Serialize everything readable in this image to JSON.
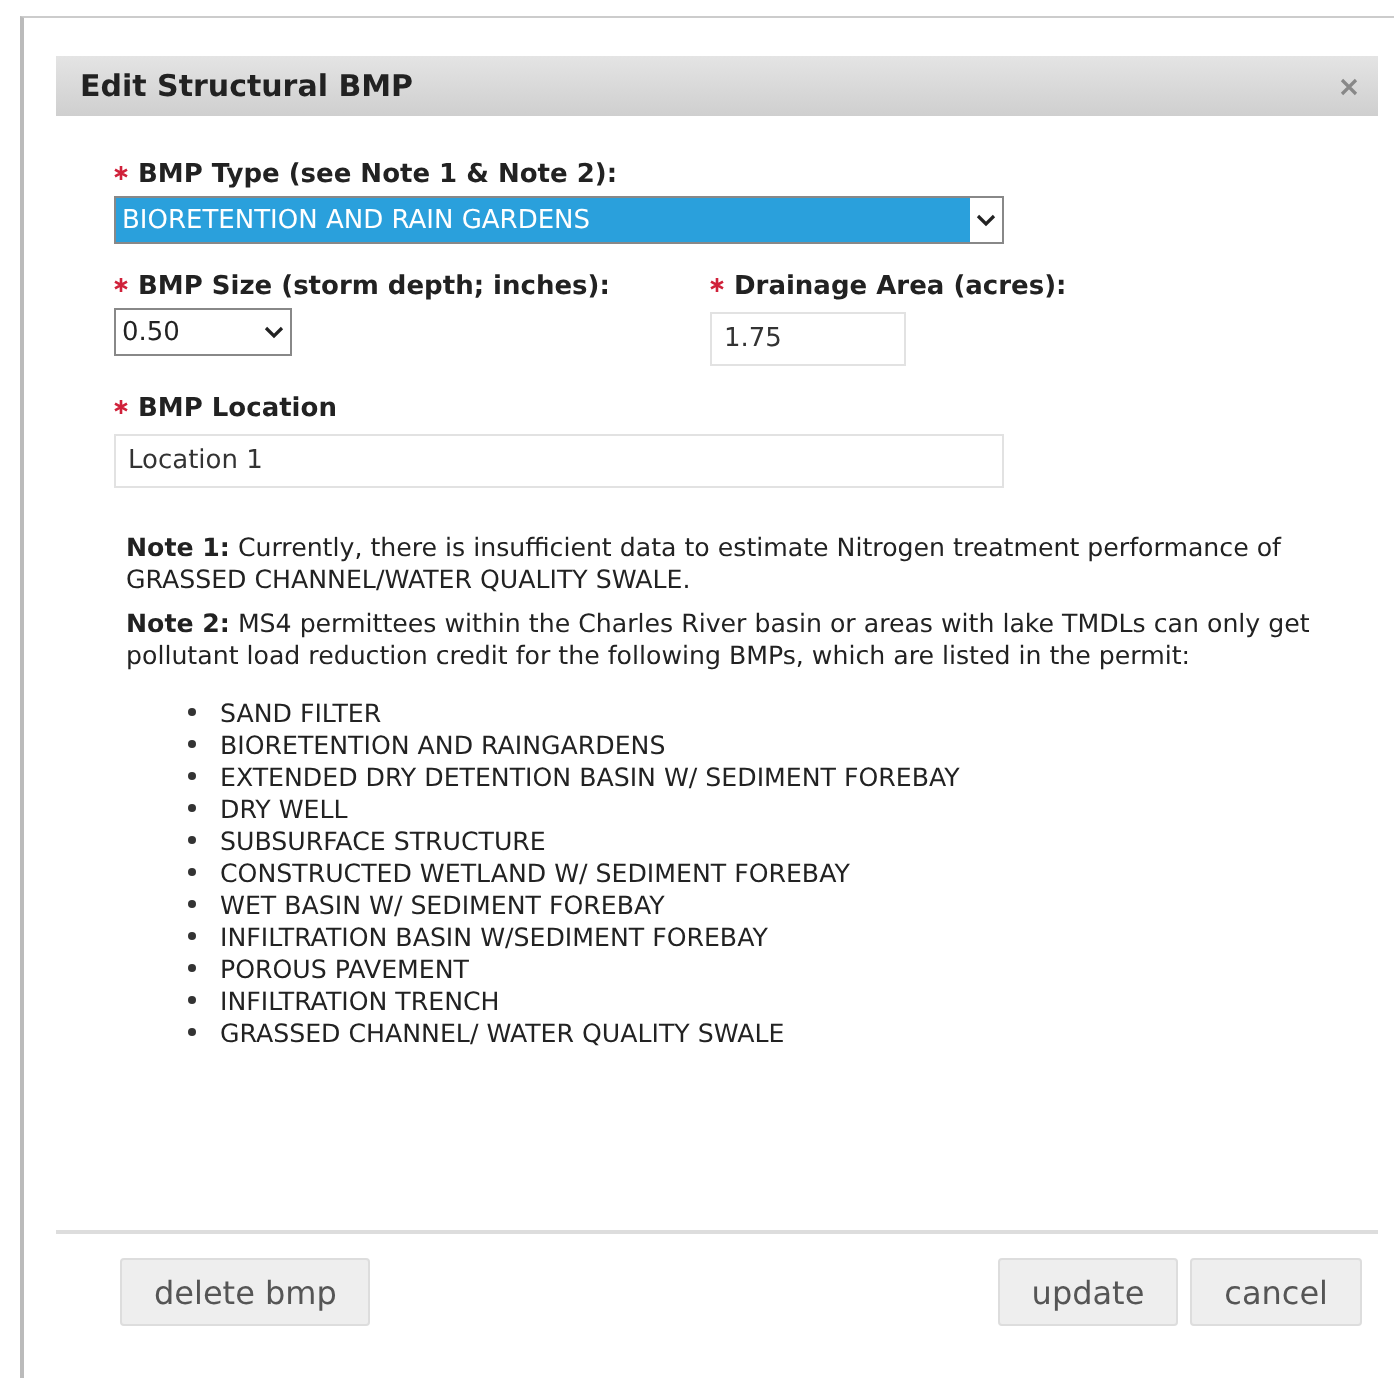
{
  "dialog": {
    "title": "Edit Structural BMP"
  },
  "fields": [
    {
      "kind": "select",
      "label": "BMP Type (see Note 1 & Note 2):",
      "required": true,
      "value": "BIORETENTION AND RAIN GARDENS",
      "highlighted": true
    },
    {
      "kind": "select",
      "label": "BMP Size (storm depth; inches):",
      "required": true,
      "value": "0.50",
      "highlighted": false
    },
    {
      "kind": "input",
      "label": "Drainage Area (acres):",
      "required": true,
      "value": "1.75"
    },
    {
      "kind": "input",
      "label": "BMP Location",
      "required": true,
      "value": "Location 1"
    }
  ],
  "notes": [
    "**Note 1:** Currently, there is insufficient data to estimate Nitrogen treatment performance of GRASSED CHANNEL/WATER QUALITY SWALE.",
    "**Note 2:** MS4 permittees within the Charles River basin or areas with lake TMDLs can only get pollutant load reduction credit for the following BMPs, which are listed in the permit:"
  ],
  "bmp_list": [
    "SAND FILTER",
    "BIORETENTION AND RAINGARDENS",
    "EXTENDED DRY DETENTION BASIN W/ SEDIMENT FOREBAY",
    "DRY WELL",
    "SUBSURFACE STRUCTURE",
    "CONSTRUCTED WETLAND W/ SEDIMENT FOREBAY",
    "WET BASIN W/ SEDIMENT FOREBAY",
    "INFILTRATION BASIN W/SEDIMENT FOREBAY",
    "POROUS PAVEMENT",
    "INFILTRATION TRENCH",
    "GRASSED CHANNEL/ WATER QUALITY SWALE"
  ],
  "footer": {
    "left_buttons": [
      "delete bmp"
    ],
    "right_buttons": [
      "update",
      "cancel"
    ]
  }
}
